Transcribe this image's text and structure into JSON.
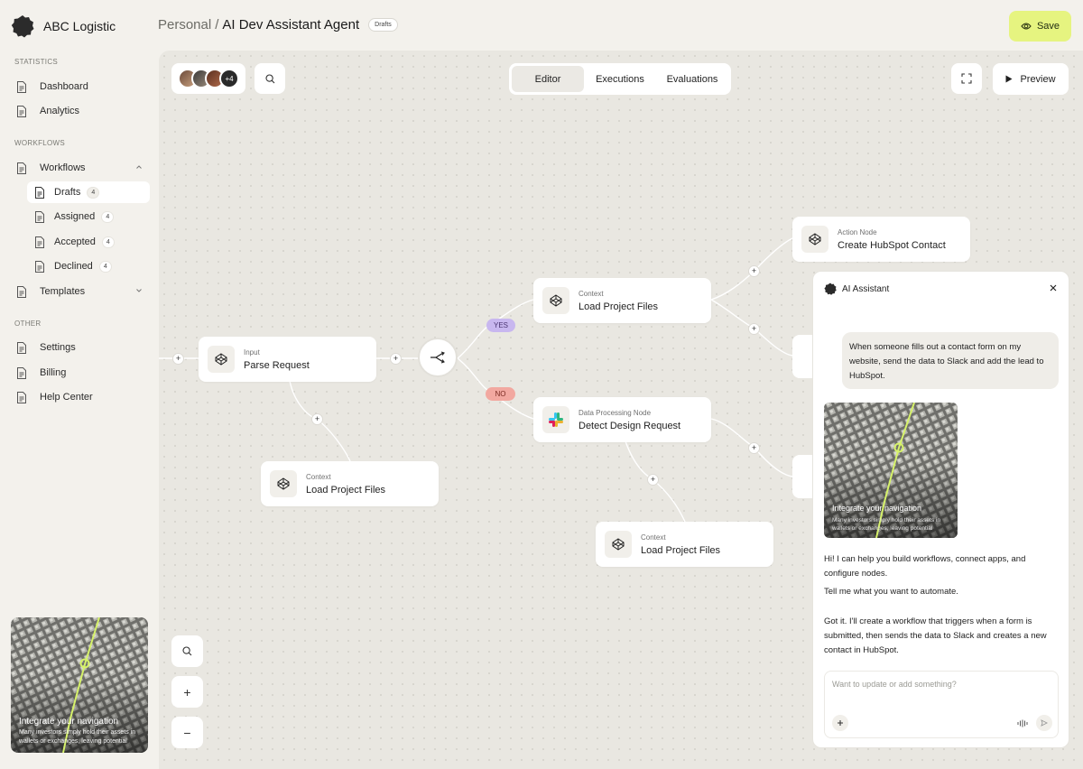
{
  "app": {
    "brand": "ABC Logistic",
    "accent_color": "#e6f480"
  },
  "sidebar": {
    "sections": [
      {
        "title": "STATISTICS"
      },
      {
        "title": "WORKFLOWS"
      },
      {
        "title": "OTHER"
      }
    ],
    "items": {
      "dashboard": "Dashboard",
      "analytics": "Analytics",
      "workflows": "Workflows",
      "drafts": {
        "label": "Drafts",
        "count": "4"
      },
      "assigned": {
        "label": "Assigned",
        "count": "4"
      },
      "accepted": {
        "label": "Accepted",
        "count": "4"
      },
      "declined": {
        "label": "Declined",
        "count": "4"
      },
      "templates": "Templates",
      "settings": "Settings",
      "billing": "Billing",
      "help": "Help Center"
    },
    "promo": {
      "title": "Integrate your navigation",
      "text": "Many investors simply hold their assets in wallets or exchanges, leaving potential"
    }
  },
  "header": {
    "breadcrumb_root": "Personal",
    "breadcrumb_sep": "/",
    "breadcrumb_current": "AI Dev Assistant Agent",
    "status_badge": "Drafts",
    "save_label": "Save"
  },
  "toolbar": {
    "avatars_more": "+4",
    "tabs": [
      "Editor",
      "Executions",
      "Evaluations"
    ],
    "active_tab": "Editor",
    "preview_label": "Preview"
  },
  "flow": {
    "nodes": {
      "parse": {
        "type": "Input",
        "title": "Parse Request"
      },
      "ctx_bottom_left": {
        "type": "Context",
        "title": "Load Project Files"
      },
      "ctx_top": {
        "type": "Context",
        "title": "Load Project Files"
      },
      "detect": {
        "type": "Data Processing Node",
        "title": "Detect Design Request"
      },
      "ctx_bottom": {
        "type": "Context",
        "title": "Load Project Files"
      },
      "hubspot": {
        "type": "Action Node",
        "title": "Create HubSpot Contact"
      }
    },
    "branch_yes": "YES",
    "branch_no": "NO",
    "plus_symbol": "+"
  },
  "zoom": {
    "zoom_in": "+",
    "zoom_out": "−"
  },
  "chat": {
    "title": "AI Assistant",
    "user_message": "When someone fills out a contact form on my website, send the data to Slack and add the lead to HubSpot.",
    "image_card": {
      "title": "Integrate your navigation",
      "text": "Many investors simply hold their assets in wallets or exchanges, leaving potential"
    },
    "assistant_messages": [
      "Hi! I can help you build workflows, connect apps, and configure nodes.",
      "Tell me what you want to automate.",
      "Got it. I'll create a workflow that triggers when a form is submitted, then sends the data to Slack and creates a new contact in HubSpot."
    ],
    "input_placeholder": "Want to update or add something?"
  }
}
